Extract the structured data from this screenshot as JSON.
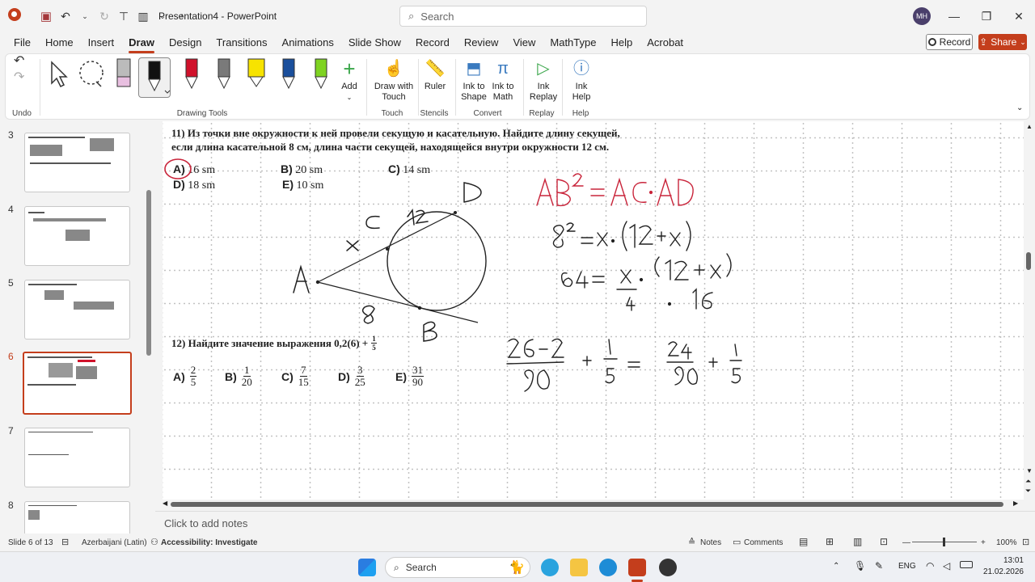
{
  "titlebar": {
    "doc_title": "Presentation4  -  PowerPoint",
    "search_placeholder": "Search",
    "avatar_initials": "MH"
  },
  "menu": {
    "tabs": [
      "File",
      "Home",
      "Insert",
      "Draw",
      "Design",
      "Transitions",
      "Animations",
      "Slide Show",
      "Record",
      "Review",
      "View",
      "MathType",
      "Help",
      "Acrobat"
    ],
    "active_tab": "Draw",
    "record_label": "Record",
    "share_label": "Share"
  },
  "ribbon": {
    "groups": {
      "undo": "Undo",
      "drawing_tools": "Drawing Tools",
      "touch": "Touch",
      "stencils": "Stencils",
      "convert": "Convert",
      "replay": "Replay",
      "help": "Help"
    },
    "buttons": {
      "add": "Add",
      "draw_with_touch": "Draw with Touch",
      "ruler": "Ruler",
      "ink_to_shape": "Ink to Shape",
      "ink_to_math": "Ink to Math",
      "ink_replay": "Ink Replay",
      "ink_help": "Ink Help"
    },
    "pen_colors": [
      "#d0112b",
      "#7a7a7a",
      "#f7e300",
      "#1a4f9c",
      "#7ed321"
    ]
  },
  "slides": {
    "numbers": [
      "3",
      "4",
      "5",
      "6",
      "7",
      "8"
    ],
    "active": "6"
  },
  "slide": {
    "problem11_line1": "11) Из точки вне окружности к ней провели секущую и касательную. Найдите длину секущей,",
    "problem11_line2": "если длина касательной 8 см, длина части секущей, находящейся внутри окружности 12 см.",
    "p11_options": [
      {
        "letter": "A)",
        "text": "16 sm"
      },
      {
        "letter": "B)",
        "text": "20 sm"
      },
      {
        "letter": "C)",
        "text": "14 sm"
      },
      {
        "letter": "D)",
        "text": "18 sm"
      },
      {
        "letter": "E)",
        "text": "10 sm"
      }
    ],
    "problem12": "12) Найдите значение выражения 0,2(6) +",
    "problem12_frac": {
      "num": "1",
      "den": "5"
    },
    "p12_options": [
      {
        "letter": "A)",
        "num": "2",
        "den": "5"
      },
      {
        "letter": "B)",
        "num": "1",
        "den": "20"
      },
      {
        "letter": "C)",
        "num": "7",
        "den": "15"
      },
      {
        "letter": "D)",
        "num": "3",
        "den": "25"
      },
      {
        "letter": "E)",
        "num": "31",
        "den": "90"
      }
    ]
  },
  "notes_placeholder": "Click to add notes",
  "status": {
    "slide_info": "Slide 6 of 13",
    "language": "Azerbaijani (Latin)",
    "accessibility": "Accessibility: Investigate",
    "notes": "Notes",
    "comments": "Comments",
    "zoom": "100%"
  },
  "taskbar": {
    "search": "Search",
    "lang": "ENG",
    "time": "13:01",
    "date": "21.02.2026"
  }
}
